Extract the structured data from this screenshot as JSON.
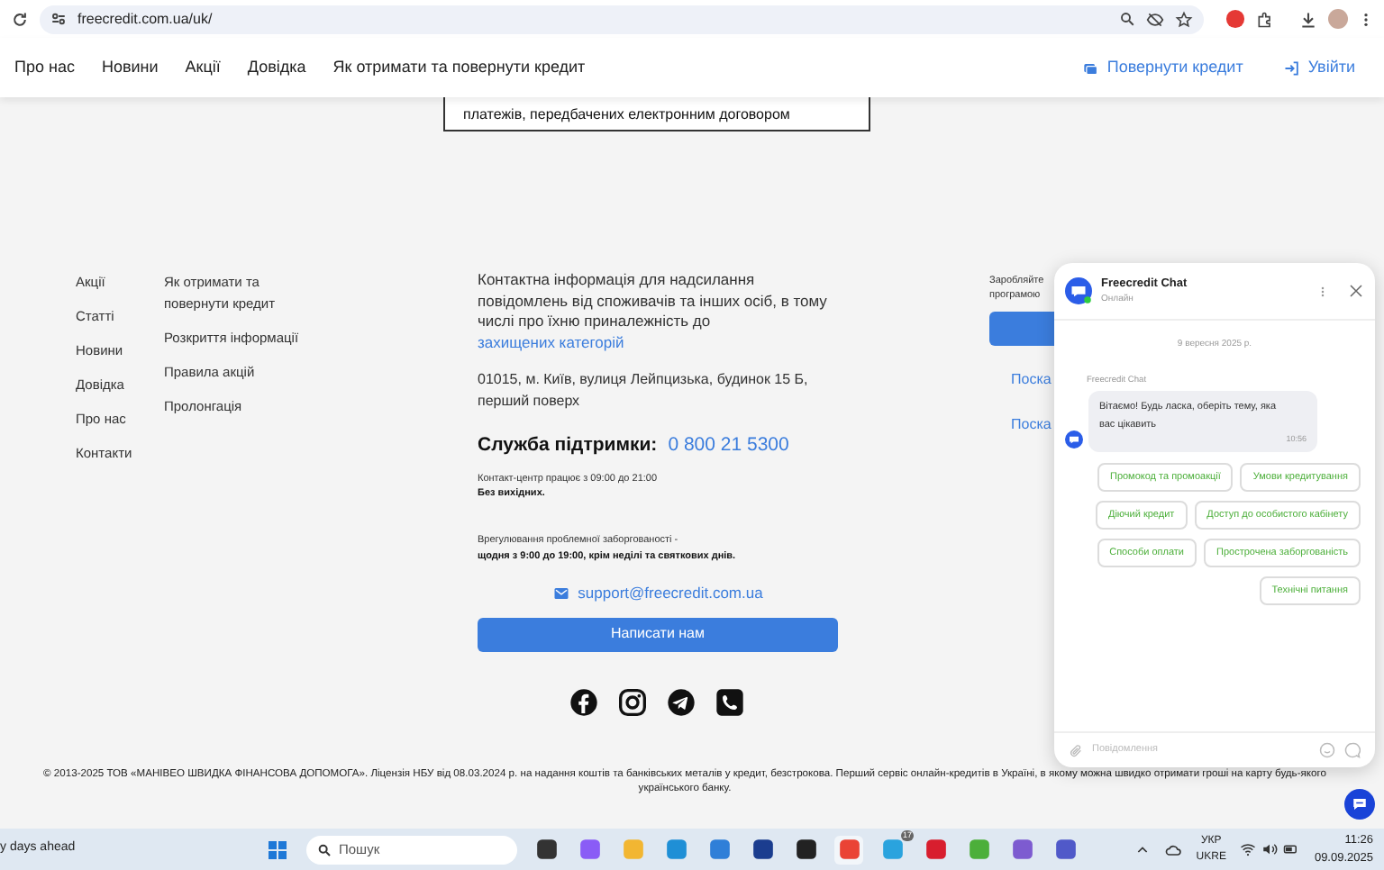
{
  "browser": {
    "url": "freecredit.com.ua/uk/"
  },
  "nav": {
    "links": [
      "Про нас",
      "Новини",
      "Акції",
      "Довідка",
      "Як отримати та повернути кредит"
    ],
    "actions": [
      {
        "kind": "repay",
        "label": "Повернути кредит"
      },
      {
        "kind": "login",
        "label": "Увійти"
      }
    ]
  },
  "document_box": {
    "line": "платежів, передбачених електронним договором"
  },
  "footer": {
    "menu_1": [
      "Акції",
      "Статті",
      "Новини",
      "Довідка",
      "Про нас",
      "Контакти"
    ],
    "menu_2": [
      "Як отримати та повернути кредит",
      "Розкриття інформації",
      "Правила акцій",
      "Пролонгація"
    ],
    "contact": {
      "text": "Контактна інформація для надсилання повідомлень від споживачів та інших осіб, в тому числі про їхню приналежність до",
      "link": "захищених категорій",
      "address": "01015, м. Київ, вулиця Лейпцизька, будинок 15 Б, перший поверх",
      "support_label": "Служба підтримки:",
      "phone": "0 800 21 5300",
      "hours": "Контакт-центр працює з 09:00 до 21:00",
      "hours_note": "Без вихідних.",
      "debt_note": "Врегулювання проблемної заборгованості -",
      "debt_hours": "щодня з 9:00 до 19:00, крім неділі та святкових днів.",
      "email": "support@freecredit.com.ua",
      "button": "Написати нам"
    },
    "partial_column": {
      "line_1": "Заробляйте",
      "line_2": "програмою",
      "links": [
        "Поска",
        "Поска"
      ]
    },
    "copyright": "© 2013-2025 ТОВ «МАНІВЕО ШВИДКА ФІНАНСОВА ДОПОМОГА». Ліцензія НБУ від 08.03.2024 р. на надання коштів та банківських металів у кредит, безстрокова. Перший сервіс онлайн-кредитів в Україні, в якому можна швидко отримати гроші на карту будь-якого українського банку."
  },
  "chat": {
    "title": "Freecredit Chat",
    "status": "Онлайн",
    "date": "9 вересня 2025 р.",
    "sender": "Freecredit Chat",
    "message": "Вітаємо! Будь ласка, оберіть тему, яка вас цікавить",
    "time": "10:56",
    "quick_replies": [
      [
        "Промокод та промоакції",
        "Умови кредитування"
      ],
      [
        "Діючий кредит",
        "Доступ до особистого кабінету"
      ],
      [
        "Способи оплати",
        "Прострочена заборгованість"
      ],
      [
        "Технічні питання"
      ]
    ],
    "placeholder": "Повідомлення"
  },
  "taskbar": {
    "weather": "y days ahead",
    "search_placeholder": "Пошук",
    "badge": "17",
    "language": "УКР",
    "layout": "UKRE",
    "time": "11:26",
    "date": "09.09.2025"
  }
}
